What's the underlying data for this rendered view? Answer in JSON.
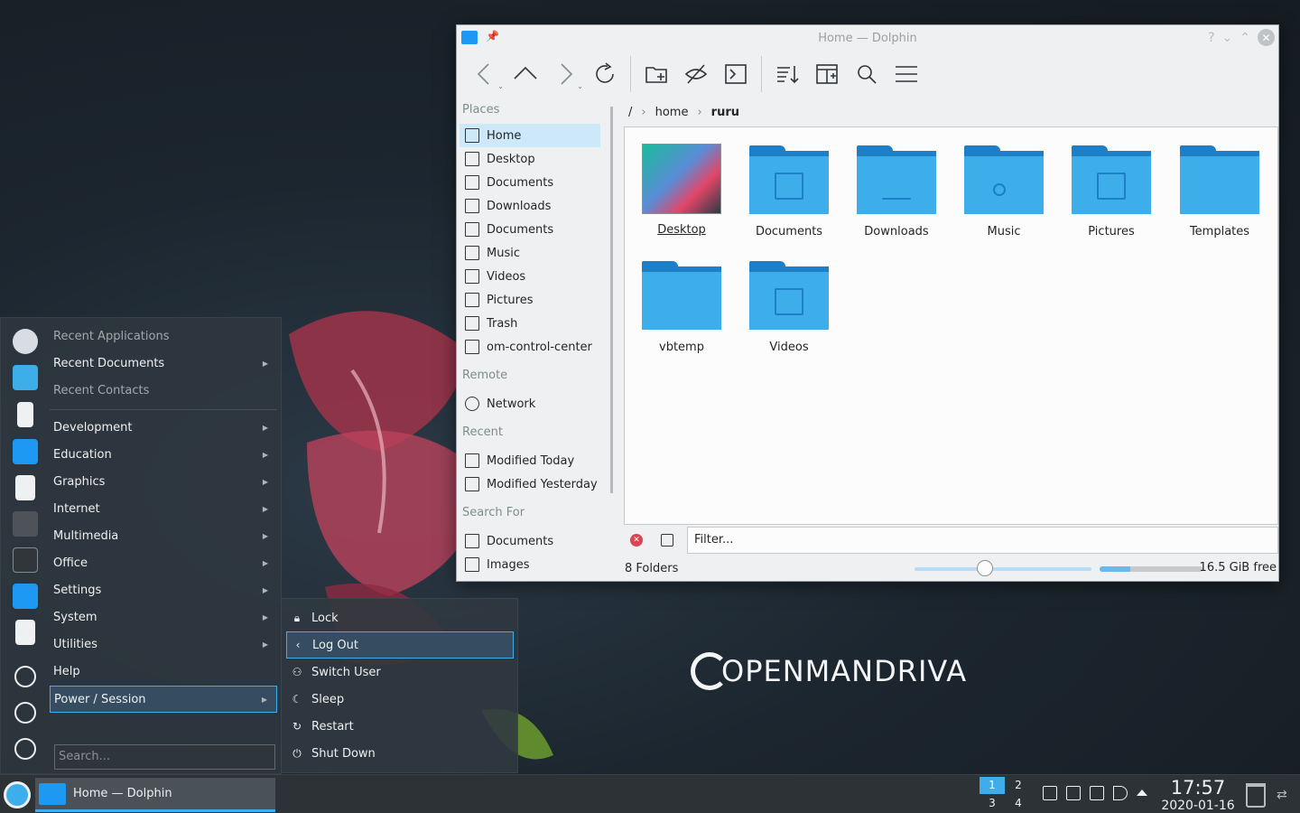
{
  "brand": {
    "text": "OPENMANDRIVA"
  },
  "window": {
    "title": "Home — Dolphin",
    "toolbar": {
      "back": "arrow-left-icon",
      "up": "arrow-up-icon",
      "forward": "arrow-right-icon",
      "reload": "reload-icon",
      "new_folder": "new-folder-icon",
      "hidden": "hidden-files-icon",
      "terminal": "terminal-icon",
      "sort": "sort-icon",
      "split": "split-view-icon",
      "search": "search-icon",
      "menu": "hamburger-menu-icon"
    },
    "breadcrumb": {
      "root": "/",
      "items": [
        "home",
        "ruru"
      ]
    },
    "places": {
      "sections": [
        {
          "title": "Places",
          "items": [
            "Home",
            "Desktop",
            "Documents",
            "Downloads",
            "Documents",
            "Music",
            "Videos",
            "Pictures",
            "Trash",
            "om-control-center"
          ]
        },
        {
          "title": "Remote",
          "items": [
            "Network"
          ]
        },
        {
          "title": "Recent",
          "items": [
            "Modified Today",
            "Modified Yesterday"
          ]
        },
        {
          "title": "Search For",
          "items": [
            "Documents",
            "Images"
          ]
        }
      ],
      "selected": "Home"
    },
    "files": [
      "Desktop",
      "Documents",
      "Downloads",
      "Music",
      "Pictures",
      "Templates",
      "vbtemp",
      "Videos"
    ],
    "filter": {
      "placeholder": "Filter..."
    },
    "status": {
      "count": "8 Folders",
      "free": "16.5 GiB free",
      "space_used_fraction": 0.3
    }
  },
  "menu": {
    "top_items": [
      "Recent Applications",
      "Recent Documents",
      "Recent Contacts"
    ],
    "categories": [
      "Development",
      "Education",
      "Graphics",
      "Internet",
      "Multimedia",
      "Office",
      "Settings",
      "System",
      "Utilities",
      "Help",
      "Power / Session"
    ],
    "search_placeholder": "Search...",
    "power_submenu": [
      "Lock",
      "Log Out",
      "Switch User",
      "Sleep",
      "Restart",
      "Shut Down"
    ]
  },
  "taskbar": {
    "task_label": "Home — Dolphin",
    "desktops": [
      "1",
      "2",
      "3",
      "4"
    ],
    "time": "17:57",
    "date": "2020-01-16"
  },
  "colors": {
    "accent": "#3daee9",
    "folder": "#3daee9",
    "folder_dark": "#1d7fc7",
    "panel": "#2d3237"
  }
}
